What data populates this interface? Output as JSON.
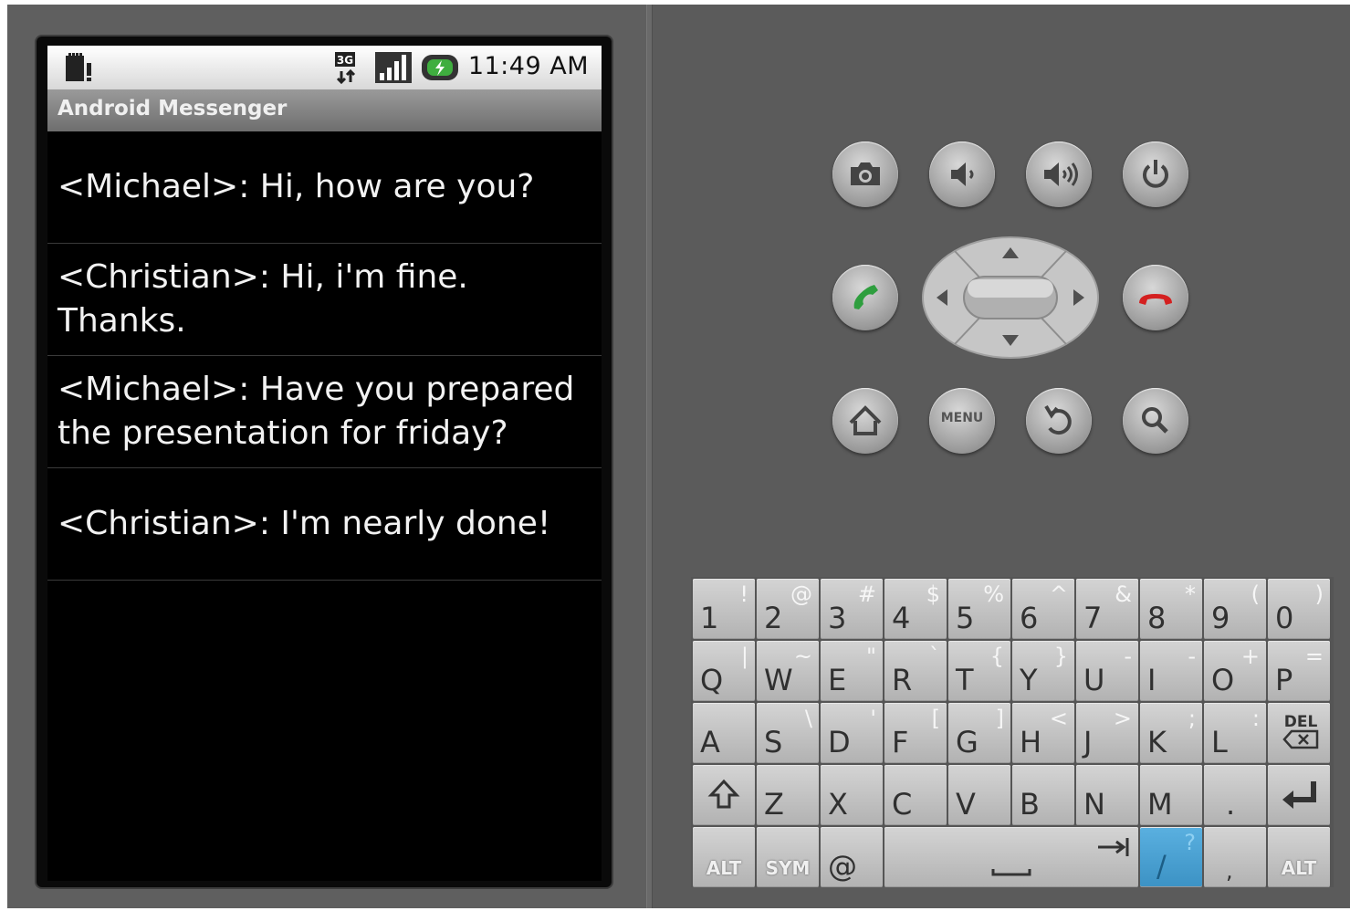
{
  "status_bar": {
    "network": "3G",
    "time": "11:49 AM"
  },
  "app": {
    "title": "Android Messenger"
  },
  "messages": [
    "<Michael>: Hi, how are you?",
    "<Christian>: Hi, i'm fine. Thanks.",
    "<Michael>: Have you prepared the presentation for friday?",
    "<Christian>: I'm nearly done!"
  ],
  "hardware_buttons": {
    "menu_label": "MENU"
  },
  "keyboard": {
    "row1": [
      {
        "main": "1",
        "alt": "!"
      },
      {
        "main": "2",
        "alt": "@"
      },
      {
        "main": "3",
        "alt": "#"
      },
      {
        "main": "4",
        "alt": "$"
      },
      {
        "main": "5",
        "alt": "%"
      },
      {
        "main": "6",
        "alt": "^"
      },
      {
        "main": "7",
        "alt": "&"
      },
      {
        "main": "8",
        "alt": "*"
      },
      {
        "main": "9",
        "alt": "("
      },
      {
        "main": "0",
        "alt": ")"
      }
    ],
    "row2": [
      {
        "main": "Q",
        "alt": "|"
      },
      {
        "main": "W",
        "alt": "~"
      },
      {
        "main": "E",
        "alt": "\""
      },
      {
        "main": "R",
        "alt": "`"
      },
      {
        "main": "T",
        "alt": "{"
      },
      {
        "main": "Y",
        "alt": "}"
      },
      {
        "main": "U",
        "alt": "-"
      },
      {
        "main": "I",
        "alt": "-"
      },
      {
        "main": "O",
        "alt": "+"
      },
      {
        "main": "P",
        "alt": "="
      }
    ],
    "row3": [
      {
        "main": "A",
        "alt": ""
      },
      {
        "main": "S",
        "alt": "\\"
      },
      {
        "main": "D",
        "alt": "'"
      },
      {
        "main": "F",
        "alt": "["
      },
      {
        "main": "G",
        "alt": "]"
      },
      {
        "main": "H",
        "alt": "<"
      },
      {
        "main": "J",
        "alt": ">"
      },
      {
        "main": "K",
        "alt": ";"
      },
      {
        "main": "L",
        "alt": ":"
      }
    ],
    "del_label": "DEL",
    "row4": [
      {
        "main": "Z",
        "alt": ""
      },
      {
        "main": "X",
        "alt": ""
      },
      {
        "main": "C",
        "alt": ""
      },
      {
        "main": "V",
        "alt": ""
      },
      {
        "main": "B",
        "alt": ""
      },
      {
        "main": "N",
        "alt": ""
      },
      {
        "main": "M",
        "alt": ""
      },
      {
        "main": ".",
        "alt": ""
      }
    ],
    "alt_label": "ALT",
    "sym_label": "SYM",
    "at_label": "@",
    "slash": {
      "main": "/",
      "alt": "?"
    },
    "comma": ","
  },
  "colors": {
    "highlight_key": "#4aa3d6",
    "call_green": "#2e9e3e",
    "end_red": "#d42020"
  }
}
